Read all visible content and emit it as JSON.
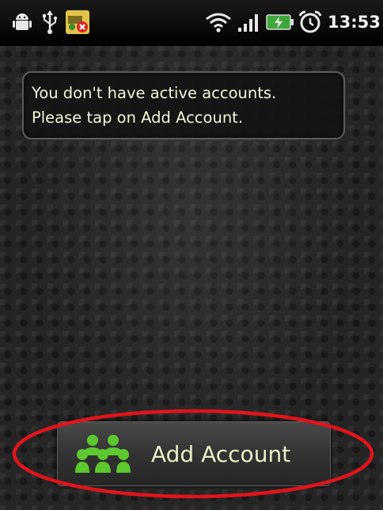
{
  "status_bar": {
    "time": "13:53",
    "icons": [
      "android-icon",
      "usb-icon",
      "notification-error-icon",
      "wifi-icon",
      "signal-icon",
      "battery-charging-icon",
      "alarm-icon"
    ]
  },
  "message": {
    "line1": "You don't have active accounts.",
    "line2": "Please tap on Add Account."
  },
  "add_account": {
    "label": "Add Account",
    "icon": "accounts-icon"
  },
  "colors": {
    "icon_green": "#5cc72e",
    "highlight_red": "#e0141b",
    "text": "#f4f4d8"
  }
}
